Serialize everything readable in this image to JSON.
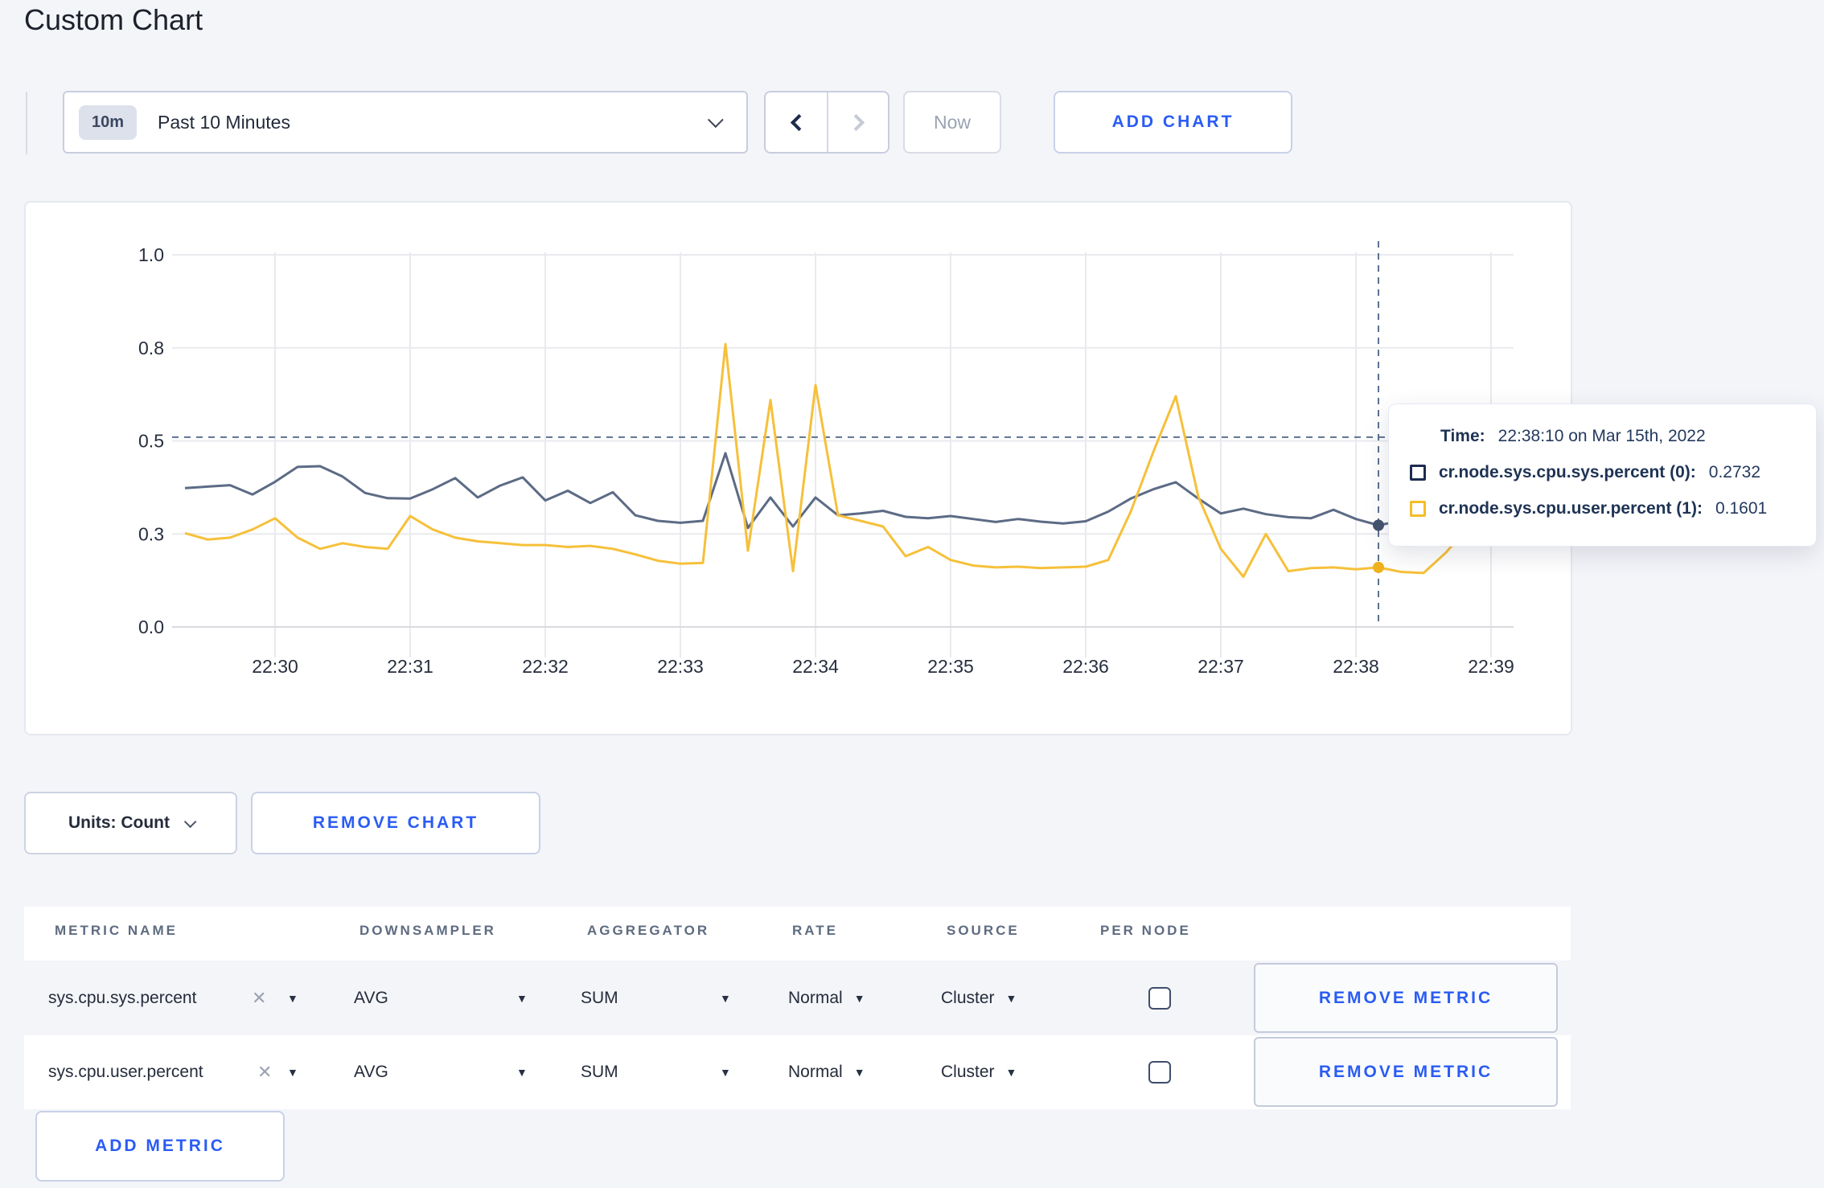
{
  "page": {
    "title": "Custom Chart",
    "background": "#f4f5f9",
    "accent_blue": "#2a5cf4"
  },
  "toolbar": {
    "time_range": {
      "badge": "10m",
      "label": "Past 10 Minutes"
    },
    "now_label": "Now",
    "add_chart_label": "ADD CHART"
  },
  "tooltip": {
    "time_label": "Time:",
    "time_value": "22:38:10 on Mar 15th, 2022",
    "series": [
      {
        "name": "cr.node.sys.cpu.sys.percent (0):",
        "value": "0.2732",
        "color": "#1d2c50"
      },
      {
        "name": "cr.node.sys.cpu.user.percent (1):",
        "value": "0.1601",
        "color": "#f5bd27"
      }
    ]
  },
  "units": {
    "label": "Units: Count"
  },
  "remove_chart_label": "REMOVE CHART",
  "metrics_table": {
    "columns": [
      "METRIC NAME",
      "DOWNSAMPLER",
      "AGGREGATOR",
      "RATE",
      "SOURCE",
      "PER NODE"
    ],
    "rows": [
      {
        "metric_name": "sys.cpu.sys.percent",
        "downsampler": "AVG",
        "aggregator": "SUM",
        "rate": "Normal",
        "source": "Cluster",
        "per_node_checked": false,
        "remove_label": "REMOVE METRIC"
      },
      {
        "metric_name": "sys.cpu.user.percent",
        "downsampler": "AVG",
        "aggregator": "SUM",
        "rate": "Normal",
        "source": "Cluster",
        "per_node_checked": false,
        "remove_label": "REMOVE METRIC"
      }
    ],
    "add_metric_label": "ADD METRIC"
  },
  "chart_data": {
    "type": "line",
    "title": "",
    "xlabel": "",
    "ylabel": "",
    "ylim": [
      0,
      1
    ],
    "grid": true,
    "x_ticks": [
      "22:30",
      "22:31",
      "22:32",
      "22:33",
      "22:34",
      "22:35",
      "22:36",
      "22:37",
      "22:38",
      "22:39"
    ],
    "y_ticks": {
      "values": [
        0,
        0.25,
        0.5,
        0.75,
        1.0
      ],
      "labels": [
        "0.0",
        "0.3",
        "0.5",
        "0.8",
        "1.0"
      ]
    },
    "start_time": "22:29:20",
    "interval_seconds": 10,
    "series": [
      {
        "name": "cr.node.sys.cpu.sys.percent",
        "color": "#5c6b85",
        "values": [
          0.373,
          0.377,
          0.381,
          0.356,
          0.39,
          0.43,
          0.432,
          0.404,
          0.36,
          0.346,
          0.345,
          0.37,
          0.4,
          0.348,
          0.38,
          0.402,
          0.34,
          0.366,
          0.333,
          0.362,
          0.3,
          0.285,
          0.28,
          0.285,
          0.467,
          0.266,
          0.348,
          0.27,
          0.348,
          0.3,
          0.305,
          0.312,
          0.296,
          0.292,
          0.298,
          0.29,
          0.282,
          0.29,
          0.283,
          0.278,
          0.284,
          0.31,
          0.345,
          0.37,
          0.389,
          0.345,
          0.305,
          0.318,
          0.303,
          0.295,
          0.292,
          0.315,
          0.29,
          0.2732,
          0.285,
          0.295,
          0.3,
          0.29,
          0.285,
          0.298
        ]
      },
      {
        "name": "cr.node.sys.cpu.user.percent",
        "color": "#f6c03a",
        "values": [
          0.252,
          0.235,
          0.24,
          0.262,
          0.292,
          0.24,
          0.21,
          0.225,
          0.215,
          0.21,
          0.298,
          0.262,
          0.24,
          0.23,
          0.225,
          0.22,
          0.22,
          0.215,
          0.218,
          0.21,
          0.195,
          0.178,
          0.17,
          0.172,
          0.76,
          0.205,
          0.61,
          0.15,
          0.65,
          0.3,
          0.285,
          0.27,
          0.19,
          0.215,
          0.18,
          0.165,
          0.16,
          0.162,
          0.158,
          0.16,
          0.162,
          0.18,
          0.31,
          0.47,
          0.62,
          0.35,
          0.21,
          0.135,
          0.25,
          0.15,
          0.158,
          0.16,
          0.155,
          0.1601,
          0.148,
          0.145,
          0.2,
          0.27,
          0.28,
          0.245
        ]
      }
    ],
    "crosshair": {
      "time": "22:38:10",
      "hover_value_line": 0.51,
      "point_index": 53,
      "point_values": [
        0.2732,
        0.1601
      ],
      "dot_colors": [
        "#44536e",
        "#efb11d"
      ]
    },
    "legend_position": "tooltip",
    "colors": {
      "grid": "#e9eaee",
      "axis": "#d8dadf",
      "dashed": "#5d7291",
      "tick_text": "#272e3e"
    }
  }
}
